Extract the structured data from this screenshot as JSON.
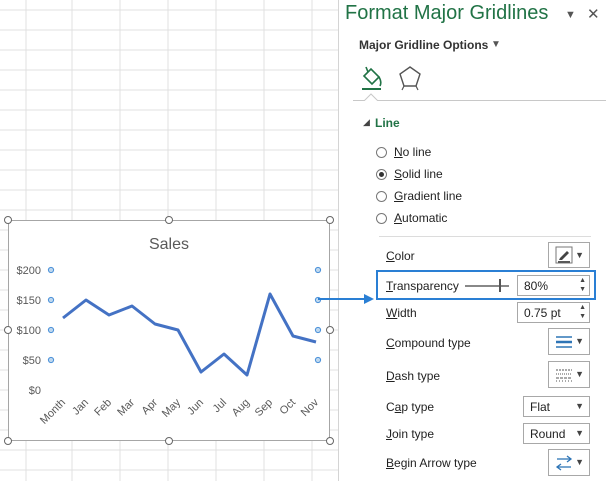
{
  "chart_data": {
    "type": "line",
    "title": "Sales",
    "categories": [
      "Month",
      "Jan",
      "Feb",
      "Mar",
      "Apr",
      "May",
      "Jun",
      "Jul",
      "Aug",
      "Sep",
      "Oct",
      "Nov"
    ],
    "series": [
      {
        "values": [
          120,
          150,
          125,
          140,
          110,
          100,
          30,
          60,
          25,
          160,
          90,
          80
        ]
      }
    ],
    "y_ticks": [
      "$200",
      "$150",
      "$100",
      "$50",
      "$0"
    ],
    "y_tick_values": [
      200,
      150,
      100,
      50,
      0
    ],
    "ylim": [
      0,
      200
    ],
    "grid": false,
    "line_color": "#4472c4"
  },
  "pane": {
    "title": "Format Major Gridlines",
    "options_label": "Major Gridline Options",
    "tabs": [
      "fill-line-icon",
      "effects-icon"
    ],
    "section_label": "Line",
    "line_options": [
      {
        "label": "No line",
        "ul": "N",
        "rest": "o line",
        "selected": false
      },
      {
        "label": "Solid line",
        "ul": "S",
        "rest": "olid line",
        "selected": true
      },
      {
        "label": "Gradient line",
        "ul": "G",
        "rest": "radient line",
        "selected": false
      },
      {
        "label": "Automatic",
        "ul": "A",
        "rest": "utomatic",
        "selected": false
      }
    ],
    "color_label": {
      "ul": "C",
      "rest": "olor"
    },
    "transparency_label": {
      "ul": "T",
      "rest": "ransparency"
    },
    "transparency_value": "80%",
    "transparency_fraction": 0.8,
    "width_label": {
      "ul": "W",
      "rest": "idth"
    },
    "width_value": "0.75 pt",
    "compound_label": {
      "ul": "C",
      "rest": "ompound type"
    },
    "dash_label": {
      "ul": "D",
      "rest": "ash type"
    },
    "cap_label": {
      "pre": "C",
      "ul": "a",
      "rest": "p type"
    },
    "cap_value": "Flat",
    "join_label": {
      "ul": "J",
      "rest": "oin type"
    },
    "join_value": "Round",
    "begin_arrow_label": {
      "ul": "B",
      "rest": "egin Arrow type"
    },
    "accent_color": "#217346",
    "highlight_color": "#2a7fd4"
  }
}
